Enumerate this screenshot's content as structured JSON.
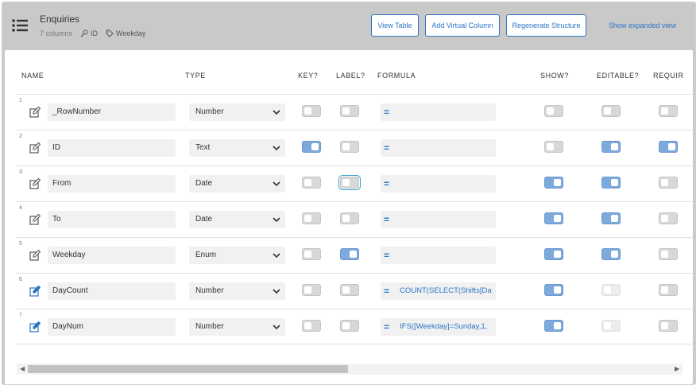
{
  "header": {
    "title": "Enquiries",
    "columns_count": "7 columns",
    "key_label": "ID",
    "label_label": "Weekday",
    "buttons": {
      "view_table": "View Table",
      "add_virtual": "Add Virtual Column",
      "regenerate": "Regenerate Structure",
      "expanded": "Show expanded view"
    }
  },
  "columns": {
    "name": "NAME",
    "type": "TYPE",
    "key": "KEY?",
    "label": "LABEL?",
    "formula": "FORMULA",
    "show": "SHOW?",
    "editable": "EDITABLE?",
    "required": "REQUIR"
  },
  "rows": [
    {
      "num": "1",
      "name": "_RowNumber",
      "type": "Number",
      "key": false,
      "label": false,
      "formula": "",
      "show": false,
      "editable": false,
      "required": false,
      "virtual": false
    },
    {
      "num": "2",
      "name": "ID",
      "type": "Text",
      "key": true,
      "label": false,
      "formula": "",
      "show": false,
      "editable": true,
      "required": true,
      "virtual": false
    },
    {
      "num": "3",
      "name": "From",
      "type": "Date",
      "key": false,
      "label": false,
      "formula": "",
      "show": true,
      "editable": true,
      "required": false,
      "virtual": false
    },
    {
      "num": "4",
      "name": "To",
      "type": "Date",
      "key": false,
      "label": false,
      "formula": "",
      "show": true,
      "editable": true,
      "required": false,
      "virtual": false
    },
    {
      "num": "5",
      "name": "Weekday",
      "type": "Enum",
      "key": false,
      "label": true,
      "formula": "",
      "show": true,
      "editable": true,
      "required": false,
      "virtual": false
    },
    {
      "num": "6",
      "name": "DayCount",
      "type": "Number",
      "key": false,
      "label": false,
      "formula": "COUNT(SELECT(Shifts[Da",
      "show": true,
      "editable": false,
      "required": false,
      "virtual": true
    },
    {
      "num": "7",
      "name": "DayNum",
      "type": "Number",
      "key": false,
      "label": false,
      "formula": "IFS([Weekday]=Sunday,1,",
      "show": true,
      "editable": false,
      "required": false,
      "virtual": true
    }
  ],
  "colors": {
    "accent": "#2b74c5",
    "toggle_on": "#7ea9dd",
    "header_bg": "#c9c9c9"
  }
}
